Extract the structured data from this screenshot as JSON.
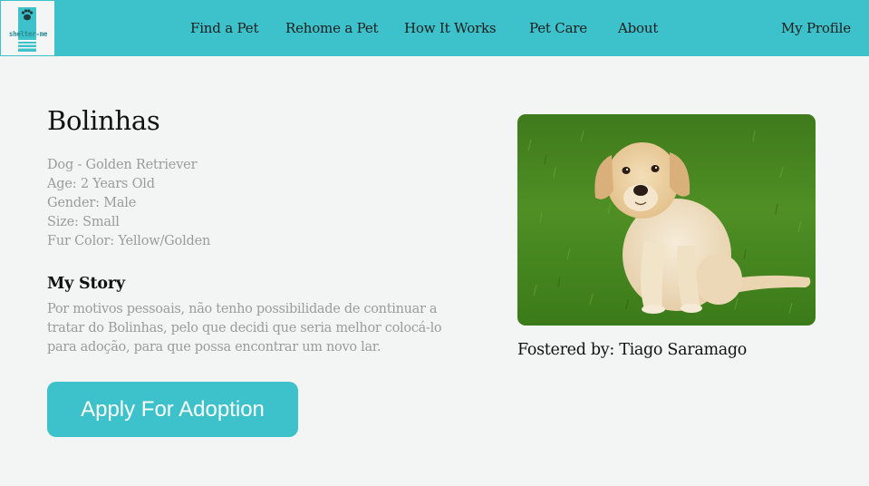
{
  "brand": {
    "logo_text": "shelter-me",
    "logo_icon": "paw-icon"
  },
  "nav": {
    "items": [
      {
        "label": "Find a Pet"
      },
      {
        "label": "Rehome a Pet"
      },
      {
        "label": "How It Works"
      },
      {
        "label": "Pet Care"
      },
      {
        "label": "About"
      }
    ],
    "profile_label": "My Profile"
  },
  "pet": {
    "name": "Bolinhas",
    "details": [
      "Dog - Golden Retriever",
      "Age: 2 Years Old",
      "Gender: Male",
      "Size: Small",
      "Fur Color: Yellow/Golden"
    ],
    "story_heading": "My Story",
    "story_text": "Por motivos pessoais, não tenho possibilidade de continuar a tratar do Bolinhas, pelo que decidi que seria melhor colocá-lo para adoção, para que possa encontrar um novo lar.",
    "photo_alt": "Golden retriever puppy sitting on grass",
    "fostered_by": "Fostered by: Tiago Saramago"
  },
  "actions": {
    "apply_label": "Apply For Adoption"
  },
  "colors": {
    "accent": "#3dc1ca",
    "background": "#f3f5f4",
    "muted_text": "#9b9b9b"
  }
}
